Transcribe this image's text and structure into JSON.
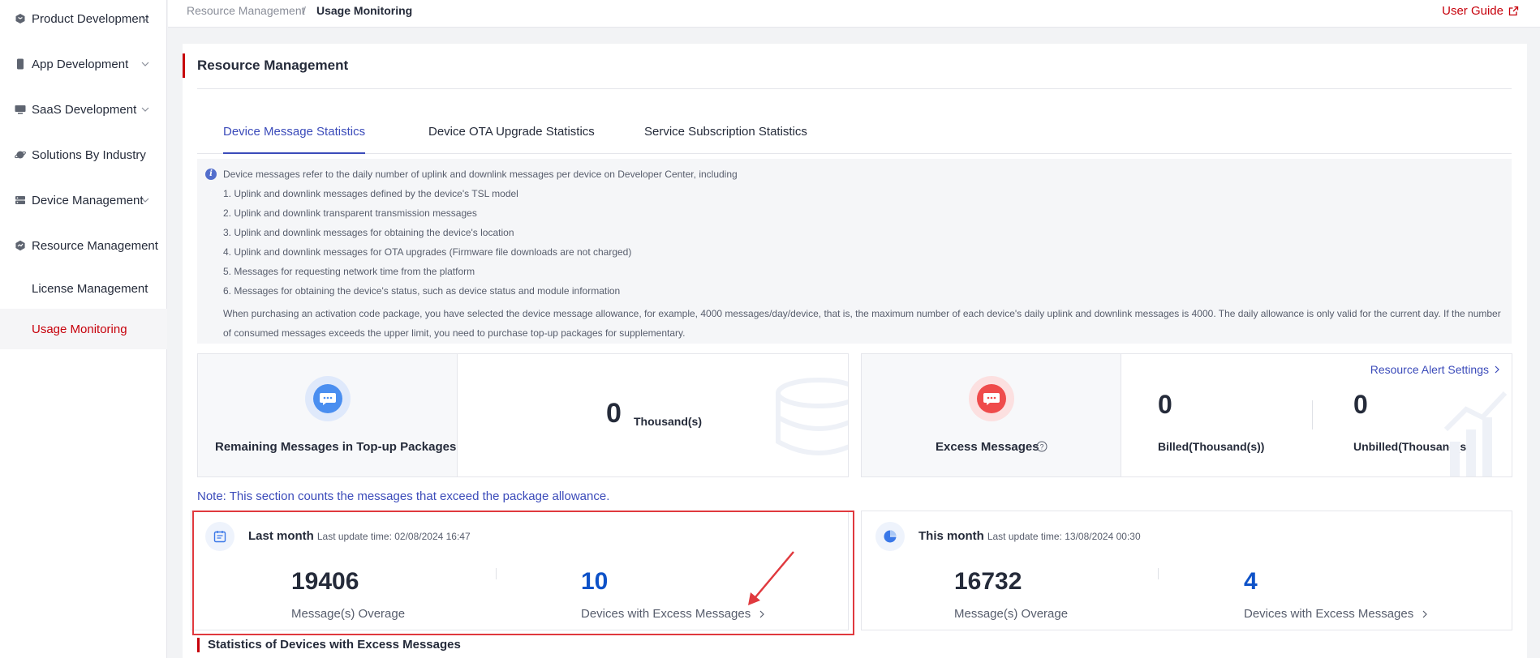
{
  "sidebar": {
    "items": [
      {
        "label": "Product Development",
        "icon": "cube-icon",
        "expandable": true
      },
      {
        "label": "App Development",
        "icon": "phone-icon",
        "expandable": true
      },
      {
        "label": "SaaS Development",
        "icon": "monitor-icon",
        "expandable": true
      },
      {
        "label": "Solutions By Industry",
        "icon": "planet-icon",
        "expandable": false
      },
      {
        "label": "Device Management",
        "icon": "server-icon",
        "expandable": true
      },
      {
        "label": "Resource Management",
        "icon": "hexagon-icon",
        "expandable": false
      }
    ],
    "subitems": [
      {
        "label": "License Management",
        "active": false
      },
      {
        "label": "Usage Monitoring",
        "active": true
      }
    ]
  },
  "breadcrumb": {
    "parent": "Resource Management",
    "separator": "/",
    "current": "Usage Monitoring"
  },
  "header": {
    "user_guide": "User Guide"
  },
  "main": {
    "title": "Resource Management",
    "tabs": [
      {
        "label": "Device Message Statistics",
        "active": true
      },
      {
        "label": "Device OTA Upgrade Statistics",
        "active": false
      },
      {
        "label": "Service Subscription Statistics",
        "active": false
      }
    ],
    "info": {
      "lines": [
        "Device messages refer to the daily number of uplink and downlink messages per device on Developer Center, including",
        "1. Uplink and downlink messages defined by the device's TSL model",
        "2. Uplink and downlink transparent transmission messages",
        "3. Uplink and downlink messages for obtaining the device's location",
        "4. Uplink and downlink messages for OTA upgrades (Firmware file downloads are not charged)",
        "5. Messages for requesting network time from the platform",
        "6. Messages for obtaining the device's status, such as device status and module information"
      ],
      "paragraph": "When purchasing an activation code package, you have selected the device message allowance, for example, 4000 messages/day/device, that is, the maximum number of each device's daily uplink and downlink messages is 4000. The daily allowance is only valid for the current day. If the number of consumed messages exceeds the upper limit, you need to purchase top-up packages for supplementary."
    },
    "remaining": {
      "label": "Remaining Messages in Top-up Packages",
      "value": "0",
      "unit": "Thousand(s)"
    },
    "excess": {
      "label": "Excess Messages",
      "alert_link": "Resource Alert Settings",
      "billed_value": "0",
      "billed_label": "Billed(Thousand(s))",
      "unbilled_value": "0",
      "unbilled_label": "Unbilled(Thousand(s))"
    },
    "note": "Note: This section counts the messages that exceed the package allowance.",
    "last_month": {
      "title": "Last month",
      "update": "Last update time: 02/08/2024 16:47",
      "overage_value": "19406",
      "overage_label": "Message(s) Overage",
      "devices_value": "10",
      "devices_label": "Devices with Excess Messages"
    },
    "this_month": {
      "title": "This month",
      "update": "Last update time: 13/08/2024 00:30",
      "overage_value": "16732",
      "overage_label": "Message(s) Overage",
      "devices_value": "4",
      "devices_label": "Devices with Excess Messages"
    },
    "bottom_title": "Statistics of Devices with Excess Messages"
  },
  "colors": {
    "accent": "#c7000b",
    "link": "#3b4bba",
    "number_blue": "#0e52c8",
    "highlight": "#e0393e"
  }
}
